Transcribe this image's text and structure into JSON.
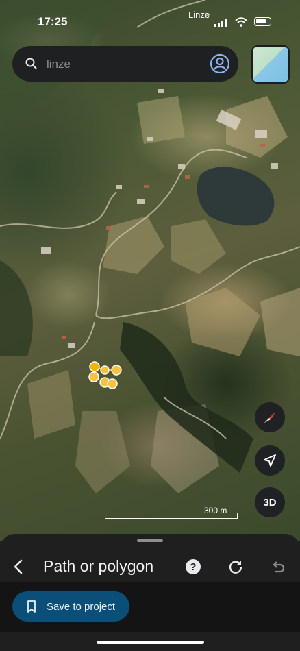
{
  "status_bar": {
    "time": "17:25",
    "location_label": "Linzë"
  },
  "search": {
    "value": "linze"
  },
  "map": {
    "scale_label": "300 m",
    "three_d_label": "3D",
    "marker_color": "#f5c242",
    "lake_color": "#2e3a3a"
  },
  "bottom_sheet": {
    "title": "Path or polygon",
    "save_label": "Save to project"
  },
  "icons": [
    "search-icon",
    "account-icon",
    "compass-icon",
    "navigation-arrow-icon",
    "chevron-left-icon",
    "help-icon",
    "refresh-icon",
    "undo-icon",
    "bookmark-icon"
  ],
  "colors": {
    "accent": "#0b4e78",
    "sheet": "#1f1f1f"
  }
}
